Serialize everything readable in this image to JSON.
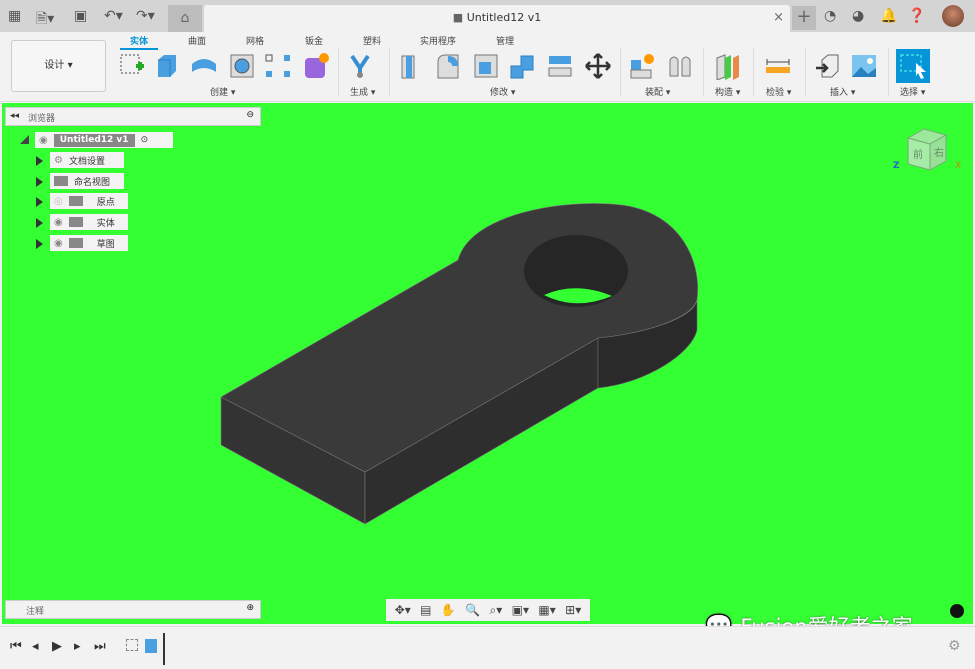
{
  "titlebar": {
    "document_title": "Untitled12 v1",
    "close": "×",
    "new_tab": "+"
  },
  "ribbon": {
    "workspace": "设计 ▾",
    "tabs": [
      "实体",
      "曲面",
      "网格",
      "钣金",
      "塑料",
      "实用程序",
      "管理"
    ],
    "groups": [
      "创建 ▾",
      "生成 ▾",
      "修改 ▾",
      "装配 ▾",
      "构造 ▾",
      "检验 ▾",
      "插入 ▾",
      "选择 ▾"
    ]
  },
  "browser": {
    "title": "浏览器",
    "root": "Untitled12 v1",
    "items": [
      "文档设置",
      "命名视图",
      "原点",
      "实体",
      "草图"
    ]
  },
  "comments": {
    "title": "注释"
  },
  "viewcube": {
    "front": "前",
    "right": "右",
    "axis_z": "Z",
    "axis_x": "X"
  },
  "watermark": "Fusion爱好者之家",
  "colors": {
    "viewport": "#33ff33",
    "accent": "#0696d7",
    "part": "#3a3a3a"
  }
}
